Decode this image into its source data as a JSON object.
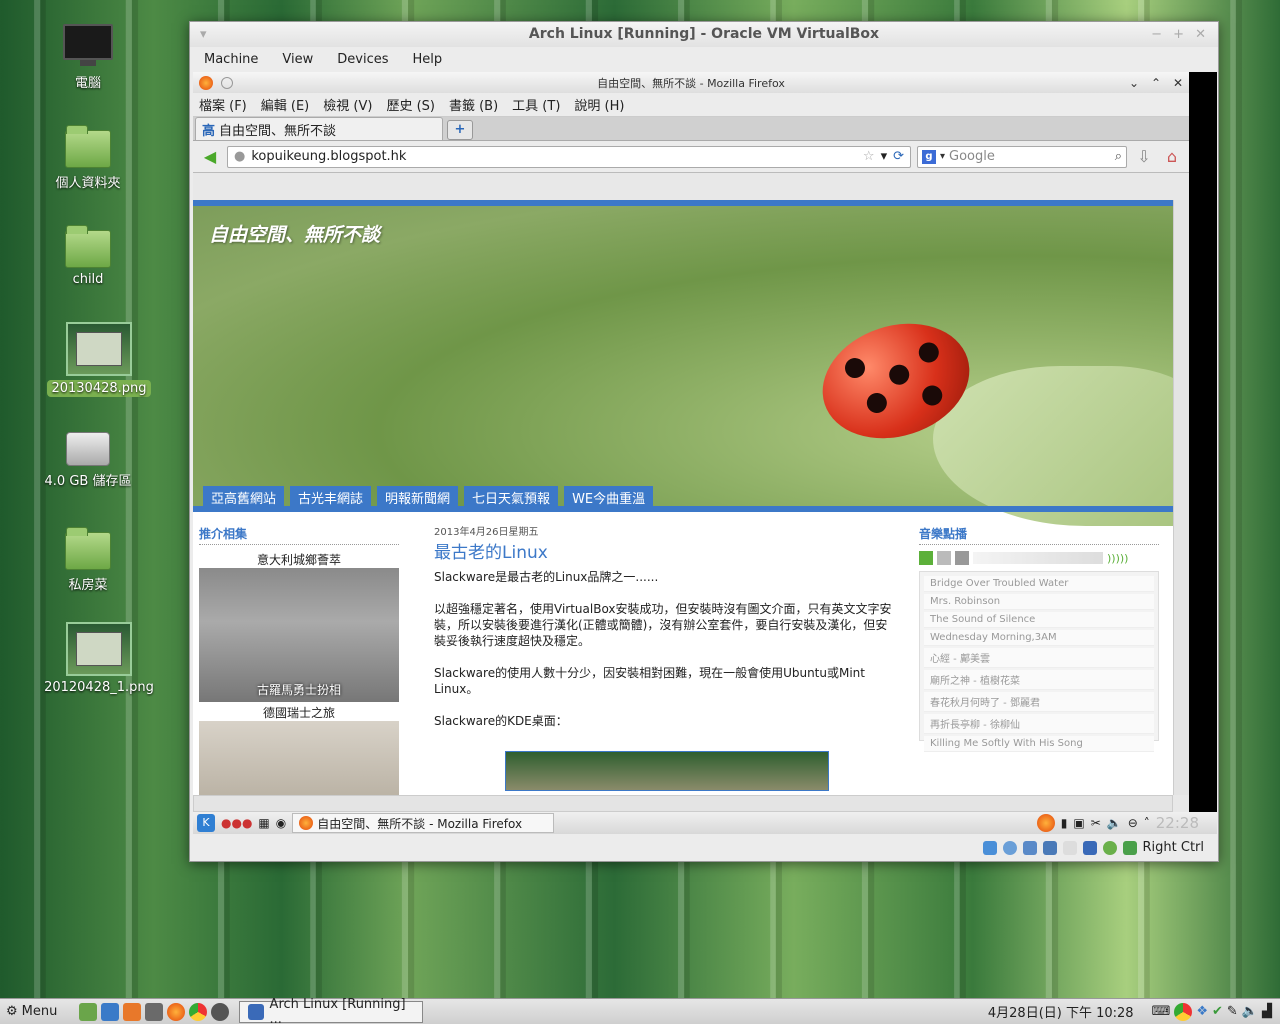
{
  "desktop": {
    "icons": [
      {
        "label": "電腦"
      },
      {
        "label": "個人資料夾"
      },
      {
        "label": "child"
      },
      {
        "label": "20130428.png"
      },
      {
        "label": "4.0 GB 儲存區"
      },
      {
        "label": "私房菜"
      },
      {
        "label": "20120428_1.png"
      }
    ]
  },
  "vbox": {
    "title": "Arch Linux [Running] - Oracle VM VirtualBox",
    "menu": [
      "Machine",
      "View",
      "Devices",
      "Help"
    ],
    "host_key": "Right Ctrl"
  },
  "firefox": {
    "window_title": "自由空間、無所不談 - Mozilla Firefox",
    "menu": [
      "檔案 (F)",
      "編輯 (E)",
      "檢視 (V)",
      "歷史 (S)",
      "書籤 (B)",
      "工具 (T)",
      "說明 (H)"
    ],
    "tab_label": "自由空間、無所不談",
    "tab_icon_char": "高",
    "new_tab_symbol": "+",
    "url": "kopuikeung.blogspot.hk",
    "search_engine": "Google"
  },
  "blog": {
    "title": "自由空間、無所不談",
    "nav": [
      "亞高舊網站",
      "古光丰網誌",
      "明報新聞網",
      "七日天氣預報",
      "WE今曲重溫"
    ],
    "left_heading": "推介相集",
    "album1_title": "意大利城鄉薈萃",
    "album1_caption": "古羅馬勇士扮相",
    "album2_title": "德國瑞士之旅",
    "post_date": "2013年4月26日星期五",
    "post_title": "最古老的Linux",
    "paragraphs": [
      "Slackware是最古老的Linux品牌之一......",
      "以超強穩定著名，使用VirtualBox安裝成功，但安裝時沒有圖文介面，只有英文文字安裝，所以安裝後要進行漢化(正體或簡體)，沒有辦公室套件，要自行安裝及漢化，但安裝妥後執行速度超快及穩定。",
      "Slackware的使用人數十分少，因安裝相對困難，現在一般會使用Ubuntu或Mint Linux。",
      "Slackware的KDE桌面："
    ],
    "right_heading": "音樂點播",
    "playlist": [
      "Bridge Over Troubled Water",
      "Mrs. Robinson",
      "The Sound of Silence",
      "Wednesday Morning,3AM",
      "心經 - 鄺美雲",
      "廟所之神 - 植樹花菜",
      "春花秋月何時了 - 鄧麗君",
      "再折長亭柳 - 徐柳仙",
      "Killing Me Softly With His Song"
    ]
  },
  "guest_panel": {
    "task": "自由空間、無所不談 - Mozilla Firefox",
    "clock": "22:28"
  },
  "host_taskbar": {
    "menu_label": "Menu",
    "task": "Arch Linux [Running] ...",
    "datetime": "4月28日(日) 下午 10:28"
  }
}
